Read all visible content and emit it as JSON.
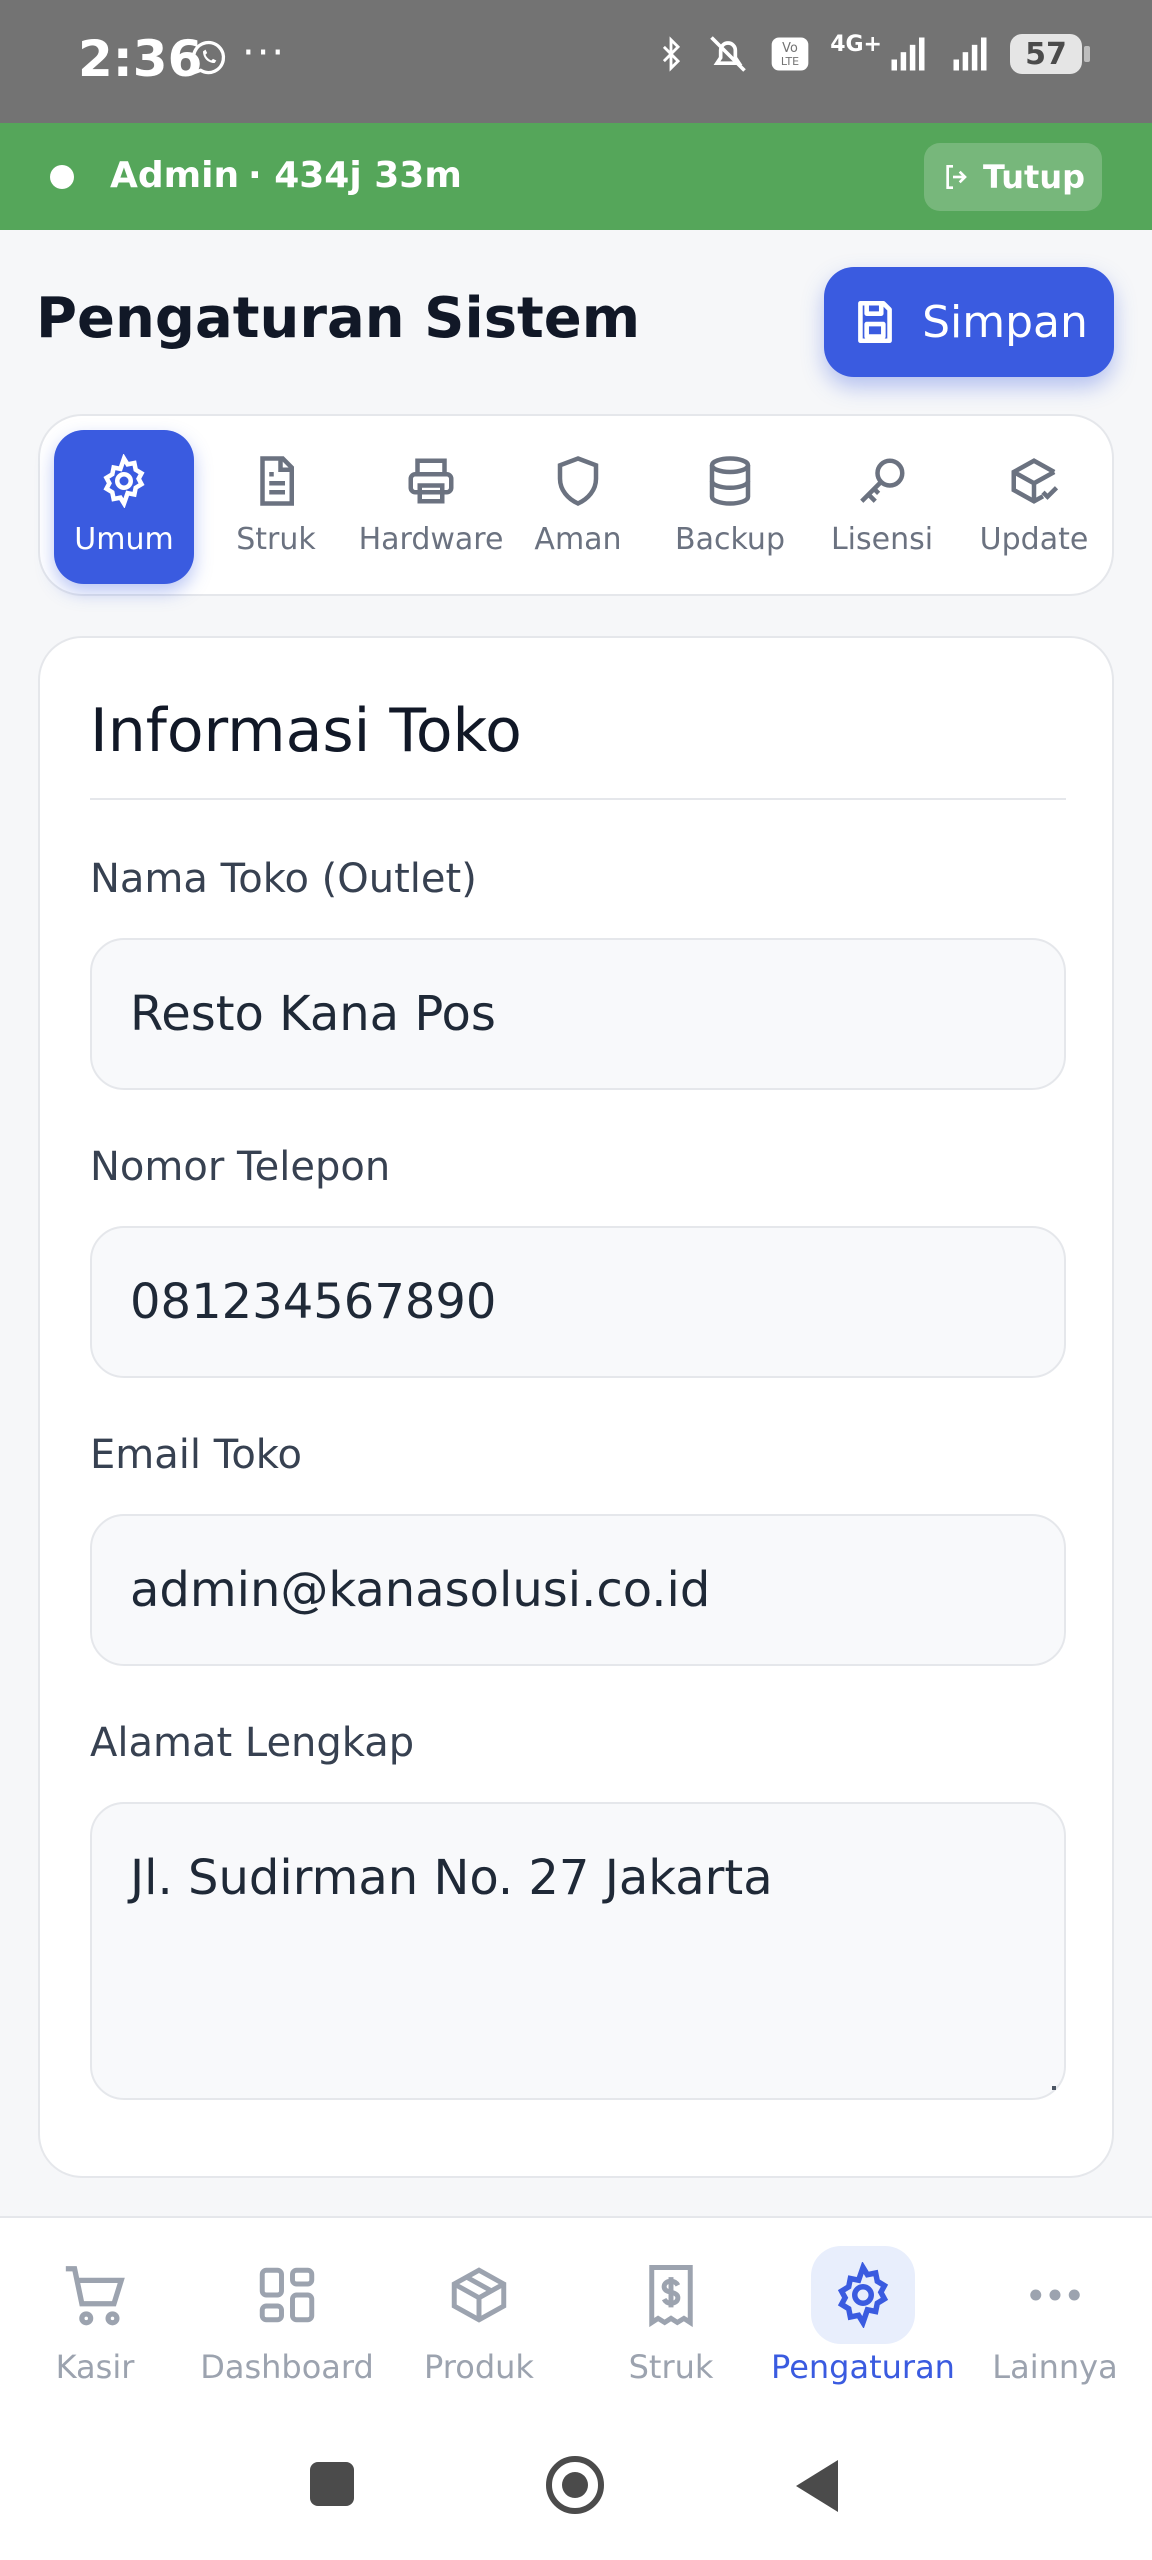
{
  "status_bar": {
    "time": "2:36",
    "battery": "57",
    "network": "4G+"
  },
  "session": {
    "user": "Admin",
    "duration": "· 434j 33m",
    "logout_label": "Tutup"
  },
  "header": {
    "title": "Pengaturan Sistem",
    "save_label": "Simpan"
  },
  "tabs": [
    {
      "label": "Umum",
      "icon": "gear-icon",
      "active": true
    },
    {
      "label": "Struk",
      "icon": "document-icon",
      "active": false
    },
    {
      "label": "Hardware",
      "icon": "printer-icon",
      "active": false
    },
    {
      "label": "Aman",
      "icon": "shield-icon",
      "active": false
    },
    {
      "label": "Backup",
      "icon": "database-icon",
      "active": false
    },
    {
      "label": "Lisensi",
      "icon": "key-icon",
      "active": false
    },
    {
      "label": "Update",
      "icon": "package-check-icon",
      "active": false
    }
  ],
  "store_info": {
    "section_title": "Informasi Toko",
    "fields": [
      {
        "label": "Nama Toko (Outlet)",
        "value": "Resto Kana Pos"
      },
      {
        "label": "Nomor Telepon",
        "value": "081234567890"
      },
      {
        "label": "Email Toko",
        "value": "admin@kanasolusi.co.id"
      },
      {
        "label": "Alamat Lengkap",
        "value": "Jl. Sudirman No. 27 Jakarta"
      }
    ]
  },
  "bottom_nav": [
    {
      "label": "Kasir",
      "icon": "cart-icon",
      "active": false
    },
    {
      "label": "Dashboard",
      "icon": "dashboard-icon",
      "active": false
    },
    {
      "label": "Produk",
      "icon": "box-icon",
      "active": false
    },
    {
      "label": "Struk",
      "icon": "receipt-icon",
      "active": false
    },
    {
      "label": "Pengaturan",
      "icon": "gear-icon",
      "active": true
    },
    {
      "label": "Lainnya",
      "icon": "more-icon",
      "active": false
    }
  ],
  "colors": {
    "accent": "#3a5be0",
    "session_bar": "#55a65a",
    "status_bar": "#737373"
  }
}
